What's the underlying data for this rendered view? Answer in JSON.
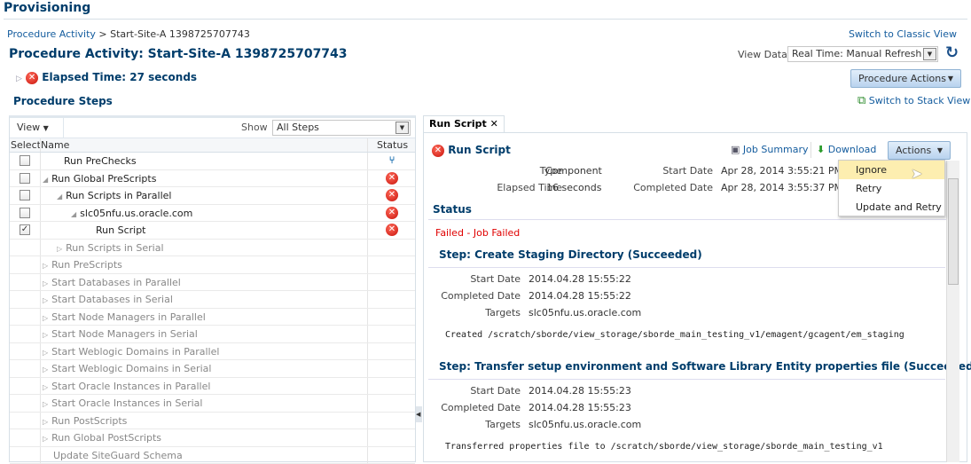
{
  "header": {
    "title": "Provisioning",
    "switch_classic": "Switch to Classic View"
  },
  "breadcrumb": {
    "link": "Procedure Activity",
    "sep": " > ",
    "current": "Start-Site-A 1398725707743"
  },
  "page_title": "Procedure Activity: Start-Site-A 1398725707743",
  "elapsed": "Elapsed Time: 27 seconds",
  "view_data": {
    "label": "View Data",
    "value": "Real Time: Manual Refresh"
  },
  "procedure_actions": "Procedure Actions",
  "switch_stack": "Switch to Stack View",
  "steps": {
    "title": "Procedure Steps",
    "view_menu": "View",
    "show_label": "Show",
    "show_value": "All Steps",
    "columns": {
      "select": "Select",
      "name": "Name",
      "status": "Status"
    },
    "rows": [
      {
        "name": "Run PreChecks",
        "level": 0,
        "checkbox": true,
        "checked": false,
        "toggle": "none",
        "status": "branch",
        "active": true
      },
      {
        "name": "Run Global PreScripts",
        "level": 0,
        "checkbox": true,
        "checked": false,
        "toggle": "expanded",
        "status": "error",
        "active": true
      },
      {
        "name": "Run Scripts in Parallel",
        "level": 1,
        "checkbox": true,
        "checked": false,
        "toggle": "expanded",
        "status": "error",
        "active": true
      },
      {
        "name": "slc05nfu.us.oracle.com",
        "level": 2,
        "checkbox": true,
        "checked": false,
        "toggle": "expanded",
        "status": "error",
        "active": true
      },
      {
        "name": "Run Script",
        "level": 3,
        "checkbox": true,
        "checked": true,
        "toggle": "none",
        "status": "error",
        "active": true
      },
      {
        "name": "Run Scripts in Serial",
        "level": 1,
        "checkbox": false,
        "toggle": "collapsed",
        "status": "",
        "active": false
      },
      {
        "name": "Run PreScripts",
        "level": 0,
        "checkbox": false,
        "toggle": "collapsed",
        "status": "",
        "active": false
      },
      {
        "name": "Start Databases in Parallel",
        "level": 0,
        "checkbox": false,
        "toggle": "collapsed",
        "status": "",
        "active": false
      },
      {
        "name": "Start Databases in Serial",
        "level": 0,
        "checkbox": false,
        "toggle": "collapsed",
        "status": "",
        "active": false
      },
      {
        "name": "Start Node Managers in Parallel",
        "level": 0,
        "checkbox": false,
        "toggle": "collapsed",
        "status": "",
        "active": false
      },
      {
        "name": "Start Node Managers in Serial",
        "level": 0,
        "checkbox": false,
        "toggle": "collapsed",
        "status": "",
        "active": false
      },
      {
        "name": "Start Weblogic Domains in Parallel",
        "level": 0,
        "checkbox": false,
        "toggle": "collapsed",
        "status": "",
        "active": false
      },
      {
        "name": "Start Weblogic Domains in Serial",
        "level": 0,
        "checkbox": false,
        "toggle": "collapsed",
        "status": "",
        "active": false
      },
      {
        "name": "Start Oracle Instances in Parallel",
        "level": 0,
        "checkbox": false,
        "toggle": "collapsed",
        "status": "",
        "active": false
      },
      {
        "name": "Start Oracle Instances in Serial",
        "level": 0,
        "checkbox": false,
        "toggle": "collapsed",
        "status": "",
        "active": false
      },
      {
        "name": "Run PostScripts",
        "level": 0,
        "checkbox": false,
        "toggle": "collapsed",
        "status": "",
        "active": false
      },
      {
        "name": "Run Global PostScripts",
        "level": 0,
        "checkbox": false,
        "toggle": "collapsed",
        "status": "",
        "active": false
      },
      {
        "name": "Update SiteGuard Schema",
        "level": 0,
        "checkbox": false,
        "toggle": "none",
        "status": "",
        "active": false
      }
    ]
  },
  "detail": {
    "tab": "Run Script",
    "title": "Run Script",
    "job_summary": "Job Summary",
    "download": "Download",
    "actions": "Actions",
    "type_label": "Type",
    "type": "Component",
    "elapsed_label": "Elapsed Time",
    "elapsed": "16 seconds",
    "start_label": "Start Date",
    "start": "Apr 28, 2014 3:55:21 PM PDT",
    "completed_label": "Completed Date",
    "completed": "Apr 28, 2014 3:55:37 PM PDT",
    "status_heading": "Status",
    "status": "Failed - Job Failed",
    "steps": [
      {
        "title": "Step: Create Staging Directory (Succeeded)",
        "start": "2014.04.28 15:55:22",
        "completed": "2014.04.28 15:55:22",
        "targets": "slc05nfu.us.oracle.com",
        "output": "Created /scratch/sborde/view_storage/sborde_main_testing_v1/emagent/gcagent/em_staging"
      },
      {
        "title": "Step: Transfer setup environment and Software Library Entity properties file (Succeeded)",
        "start": "2014.04.28 15:55:23",
        "completed": "2014.04.28 15:55:23",
        "targets": "slc05nfu.us.oracle.com",
        "output": "Transferred properties file to /scratch/sborde/view_storage/sborde_main_testing_v1"
      }
    ],
    "labels": {
      "start": "Start Date",
      "completed": "Completed Date",
      "targets": "Targets"
    },
    "menu": [
      "Ignore",
      "Retry",
      "Update and Retry"
    ]
  },
  "colors": {
    "heading": "#003d6b",
    "link": "#145c9e",
    "error": "#e00000",
    "highlight": "#fdeeb0"
  }
}
